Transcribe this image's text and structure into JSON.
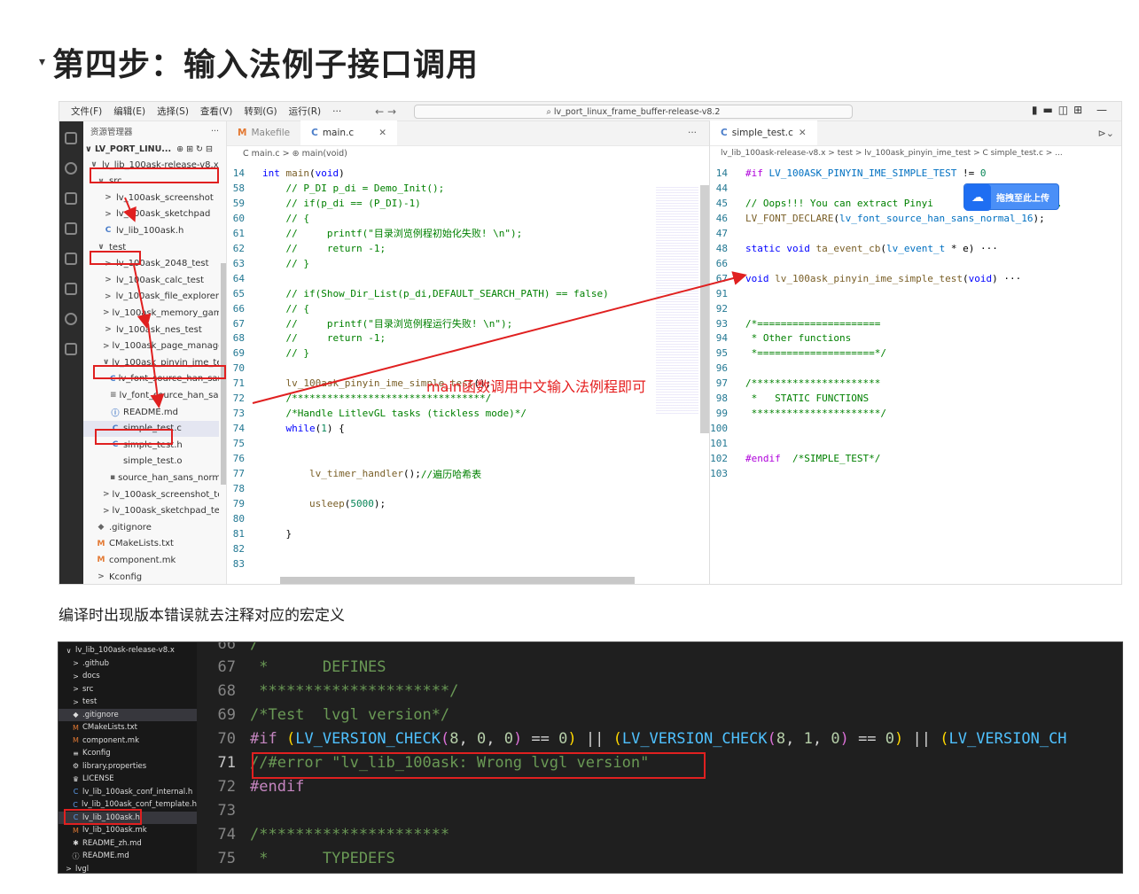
{
  "heading": {
    "text": "第四步：输入法例子接口调用"
  },
  "ss1": {
    "menu": [
      "文件(F)",
      "编辑(E)",
      "选择(S)",
      "查看(V)",
      "转到(G)",
      "运行(R)",
      "···"
    ],
    "search": "⌕ lv_port_linux_frame_buffer-release-v8.2",
    "explorer_title": "资源管理器",
    "project": "LV_PORT_LINU...",
    "tree": [
      {
        "indent": 0,
        "icon": "∨",
        "t": "lv_lib_100ask-release-v8.x",
        "cls": "ic-arr"
      },
      {
        "indent": 1,
        "icon": "∨",
        "t": "src",
        "cls": "ic-arr"
      },
      {
        "indent": 2,
        "icon": ">",
        "t": "lv_100ask_screenshot",
        "cls": "ic-arr"
      },
      {
        "indent": 2,
        "icon": ">",
        "t": "lv_100ask_sketchpad",
        "cls": "ic-arr"
      },
      {
        "indent": 2,
        "icon": "C",
        "t": "lv_lib_100ask.h",
        "cls": "ic-c"
      },
      {
        "indent": 1,
        "icon": "∨",
        "t": "test",
        "cls": "ic-arr"
      },
      {
        "indent": 2,
        "icon": ">",
        "t": "lv_100ask_2048_test",
        "cls": "ic-arr"
      },
      {
        "indent": 2,
        "icon": ">",
        "t": "lv_100ask_calc_test",
        "cls": "ic-arr"
      },
      {
        "indent": 2,
        "icon": ">",
        "t": "lv_100ask_file_explorer",
        "cls": "ic-arr"
      },
      {
        "indent": 2,
        "icon": ">",
        "t": "lv_100ask_memory_gam...",
        "cls": "ic-arr"
      },
      {
        "indent": 2,
        "icon": ">",
        "t": "lv_100ask_nes_test",
        "cls": "ic-arr"
      },
      {
        "indent": 2,
        "icon": ">",
        "t": "lv_100ask_page_manage...",
        "cls": "ic-arr"
      },
      {
        "indent": 2,
        "icon": "∨",
        "t": "lv_100ask_pinyin_ime_test",
        "cls": "ic-arr"
      },
      {
        "indent": 3,
        "icon": "C",
        "t": "lv_font_source_han_san...",
        "cls": "ic-c"
      },
      {
        "indent": 3,
        "icon": "≡",
        "t": "lv_font_source_han_san...",
        "cls": "ic-arr"
      },
      {
        "indent": 3,
        "icon": "ⓘ",
        "t": "README.md",
        "cls": "ic-c"
      },
      {
        "indent": 3,
        "icon": "C",
        "t": "simple_test.c",
        "cls": "ic-c",
        "sel": true
      },
      {
        "indent": 3,
        "icon": "C",
        "t": "simple_test.h",
        "cls": "ic-c"
      },
      {
        "indent": 3,
        "icon": "",
        "t": "simple_test.o",
        "cls": "ic-arr"
      },
      {
        "indent": 3,
        "icon": "▪",
        "t": "source_han_sans_norm...",
        "cls": "ic-arr"
      },
      {
        "indent": 2,
        "icon": ">",
        "t": "lv_100ask_screenshot_test",
        "cls": "ic-arr"
      },
      {
        "indent": 2,
        "icon": ">",
        "t": "lv_100ask_sketchpad_test",
        "cls": "ic-arr"
      },
      {
        "indent": 1,
        "icon": "◆",
        "t": ".gitignore",
        "cls": "ic-arr"
      },
      {
        "indent": 1,
        "icon": "M",
        "t": "CMakeLists.txt",
        "cls": "ic-m"
      },
      {
        "indent": 1,
        "icon": "M",
        "t": "component.mk",
        "cls": "ic-m"
      },
      {
        "indent": 1,
        "icon": ">",
        "t": "Kconfig",
        "cls": "ic-arr"
      }
    ],
    "tab_makefile": "Makefile",
    "tab_main": "main.c",
    "crumb_main": "C main.c > ⊛ main(void)",
    "code_main": [
      {
        "n": "14",
        "h": [
          [
            "kw",
            "int "
          ],
          [
            "fn",
            "main"
          ],
          [
            "pl",
            "("
          ],
          [
            "kw",
            "void"
          ],
          [
            "pl",
            ")"
          ]
        ]
      },
      {
        "n": "58",
        "h": [
          [
            "cm",
            "    // P_DI p_di = Demo_Init();"
          ]
        ]
      },
      {
        "n": "59",
        "h": [
          [
            "cm",
            "    // if(p_di == (P_DI)-1)"
          ]
        ]
      },
      {
        "n": "60",
        "h": [
          [
            "cm",
            "    // {"
          ]
        ]
      },
      {
        "n": "61",
        "h": [
          [
            "cm",
            "    //     printf(\"目录浏览例程初始化失败! \\n\");"
          ]
        ]
      },
      {
        "n": "62",
        "h": [
          [
            "cm",
            "    //     return -1;"
          ]
        ]
      },
      {
        "n": "63",
        "h": [
          [
            "cm",
            "    // }"
          ]
        ]
      },
      {
        "n": "64",
        "h": []
      },
      {
        "n": "65",
        "h": [
          [
            "cm",
            "    // if(Show_Dir_List(p_di,DEFAULT_SEARCH_PATH) == false)"
          ]
        ]
      },
      {
        "n": "66",
        "h": [
          [
            "cm",
            "    // {"
          ]
        ]
      },
      {
        "n": "67",
        "h": [
          [
            "cm",
            "    //     printf(\"目录浏览例程运行失败! \\n\");"
          ]
        ]
      },
      {
        "n": "68",
        "h": [
          [
            "cm",
            "    //     return -1;"
          ]
        ]
      },
      {
        "n": "69",
        "h": [
          [
            "cm",
            "    // }"
          ]
        ]
      },
      {
        "n": "70",
        "h": []
      },
      {
        "n": "71",
        "h": [
          [
            "fn",
            "    lv_100ask_pinyin_ime_simple_test"
          ],
          [
            "pl",
            "();"
          ]
        ]
      },
      {
        "n": "72",
        "h": [
          [
            "cm",
            "    /*********************************/"
          ]
        ]
      },
      {
        "n": "73",
        "h": [
          [
            "cm",
            "    /*Handle LitlevGL tasks (tickless mode)*/"
          ]
        ]
      },
      {
        "n": "74",
        "h": [
          [
            "kw",
            "    while"
          ],
          [
            "pl",
            "("
          ],
          [
            "nm",
            "1"
          ],
          [
            "pl",
            ") {"
          ]
        ]
      },
      {
        "n": "75",
        "h": []
      },
      {
        "n": "76",
        "h": []
      },
      {
        "n": "77",
        "h": [
          [
            "fn",
            "        lv_timer_handler"
          ],
          [
            "pl",
            "();"
          ],
          [
            "cm",
            "//遍历哈希表"
          ]
        ]
      },
      {
        "n": "78",
        "h": []
      },
      {
        "n": "79",
        "h": [
          [
            "fn",
            "        usleep"
          ],
          [
            "pl",
            "("
          ],
          [
            "nm",
            "5000"
          ],
          [
            "pl",
            ");"
          ]
        ]
      },
      {
        "n": "80",
        "h": []
      },
      {
        "n": "81",
        "h": [
          [
            "pl",
            "    }"
          ]
        ]
      },
      {
        "n": "82",
        "h": []
      },
      {
        "n": "83",
        "h": []
      }
    ],
    "tab_simple": "simple_test.c",
    "crumb_simple": "lv_lib_100ask-release-v8.x > test > lv_100ask_pinyin_ime_test > C simple_test.c > ...",
    "code_simple": [
      {
        "n": "14",
        "h": [
          [
            "pp",
            "#if "
          ],
          [
            "mc",
            "LV_100ASK_PINYIN_IME_SIMPLE_TEST"
          ],
          [
            "pl",
            " != "
          ],
          [
            "nm",
            "0"
          ]
        ]
      },
      {
        "n": "44",
        "h": []
      },
      {
        "n": "45",
        "h": [
          [
            "cm",
            "// Oops!!! You can extract Pinyi"
          ],
          [
            "pl",
            "                   "
          ],
          [
            "cm",
            "it."
          ]
        ]
      },
      {
        "n": "46",
        "h": [
          [
            "fn",
            "LV_FONT_DECLARE"
          ],
          [
            "pl",
            "("
          ],
          [
            "mc",
            "lv_font_source_han_sans_normal_16"
          ],
          [
            "pl",
            ");"
          ]
        ]
      },
      {
        "n": "47",
        "h": []
      },
      {
        "n": "48",
        "h": [
          [
            "kw",
            "static void "
          ],
          [
            "fn",
            "ta_event_cb"
          ],
          [
            "pl",
            "("
          ],
          [
            "mc",
            "lv_event_t"
          ],
          [
            "pl",
            " * e)"
          ],
          [
            "pl",
            " ···"
          ]
        ]
      },
      {
        "n": "66",
        "h": []
      },
      {
        "n": "67",
        "h": [
          [
            "kw",
            "void "
          ],
          [
            "fn",
            "lv_100ask_pinyin_ime_simple_test"
          ],
          [
            "pl",
            "("
          ],
          [
            "kw",
            "void"
          ],
          [
            "pl",
            ")"
          ],
          [
            "pl",
            " ···"
          ]
        ]
      },
      {
        "n": "91",
        "h": []
      },
      {
        "n": "92",
        "h": []
      },
      {
        "n": "93",
        "h": [
          [
            "cm",
            "/*====================="
          ]
        ]
      },
      {
        "n": "94",
        "h": [
          [
            "cm",
            " * Other functions"
          ]
        ]
      },
      {
        "n": "95",
        "h": [
          [
            "cm",
            " *====================*/"
          ]
        ]
      },
      {
        "n": "96",
        "h": []
      },
      {
        "n": "97",
        "h": [
          [
            "cm",
            "/**********************"
          ]
        ]
      },
      {
        "n": "98",
        "h": [
          [
            "cm",
            " *   STATIC FUNCTIONS"
          ]
        ]
      },
      {
        "n": "99",
        "h": [
          [
            "cm",
            " **********************/"
          ]
        ]
      },
      {
        "n": "100",
        "h": []
      },
      {
        "n": "101",
        "h": []
      },
      {
        "n": "102",
        "h": [
          [
            "pp",
            "#endif"
          ],
          [
            "cm",
            "  /*SIMPLE_TEST*/"
          ]
        ]
      },
      {
        "n": "103",
        "h": []
      }
    ],
    "baidu_label": "拖拽至此上传",
    "annotation": "main函数调用中文输入法例程即可"
  },
  "caption": "编译时出现版本错误就去注释对应的宏定义",
  "ss2": {
    "tree": [
      {
        "indent": 0,
        "icon": "∨",
        "t": "lv_lib_100ask-release-v8.x"
      },
      {
        "indent": 1,
        "icon": ">",
        "t": ".github"
      },
      {
        "indent": 1,
        "icon": ">",
        "t": "docs"
      },
      {
        "indent": 1,
        "icon": ">",
        "t": "src"
      },
      {
        "indent": 1,
        "icon": ">",
        "t": "test"
      },
      {
        "indent": 1,
        "icon": "◆",
        "t": ".gitignore",
        "sel": true
      },
      {
        "indent": 1,
        "icon": "M",
        "t": "CMakeLists.txt"
      },
      {
        "indent": 1,
        "icon": "M",
        "t": "component.mk"
      },
      {
        "indent": 1,
        "icon": "≡",
        "t": "Kconfig"
      },
      {
        "indent": 1,
        "icon": "⚙",
        "t": "library.properties"
      },
      {
        "indent": 1,
        "icon": "♛",
        "t": "LICENSE"
      },
      {
        "indent": 1,
        "icon": "C",
        "t": "lv_lib_100ask_conf_internal.h"
      },
      {
        "indent": 1,
        "icon": "C",
        "t": "lv_lib_100ask_conf_template.h"
      },
      {
        "indent": 1,
        "icon": "C",
        "t": "lv_lib_100ask.h",
        "sel": true
      },
      {
        "indent": 1,
        "icon": "M",
        "t": "lv_lib_100ask.mk"
      },
      {
        "indent": 1,
        "icon": "✱",
        "t": "README_zh.md"
      },
      {
        "indent": 1,
        "icon": "ⓘ",
        "t": "README.md"
      },
      {
        "indent": 0,
        "icon": ">",
        "t": "lvgl"
      }
    ],
    "code": [
      {
        "n": "66",
        "h": [
          [
            "d-cm",
            "/"
          ]
        ]
      },
      {
        "n": "67",
        "h": [
          [
            "d-cm",
            " *      DEFINES"
          ]
        ]
      },
      {
        "n": "68",
        "h": [
          [
            "d-cm",
            " *********************/"
          ]
        ]
      },
      {
        "n": "69",
        "h": [
          [
            "d-cm",
            "/*Test  lvgl version*/"
          ]
        ]
      },
      {
        "n": "70",
        "h": [
          [
            "d-pp",
            "#if "
          ],
          [
            "d-op",
            "("
          ],
          [
            "d-fn",
            "LV_VERSION_CHECK"
          ],
          [
            "d-br",
            "("
          ],
          [
            "d-nm",
            "8"
          ],
          [
            "d-pl",
            ", "
          ],
          [
            "d-nm",
            "0"
          ],
          [
            "d-pl",
            ", "
          ],
          [
            "d-nm",
            "0"
          ],
          [
            "d-br",
            ")"
          ],
          [
            "d-pl",
            " == "
          ],
          [
            "d-nm",
            "0"
          ],
          [
            "d-op",
            ")"
          ],
          [
            "d-pl",
            " || "
          ],
          [
            "d-op",
            "("
          ],
          [
            "d-fn",
            "LV_VERSION_CHECK"
          ],
          [
            "d-br",
            "("
          ],
          [
            "d-nm",
            "8"
          ],
          [
            "d-pl",
            ", "
          ],
          [
            "d-nm",
            "1"
          ],
          [
            "d-pl",
            ", "
          ],
          [
            "d-nm",
            "0"
          ],
          [
            "d-br",
            ")"
          ],
          [
            "d-pl",
            " == "
          ],
          [
            "d-nm",
            "0"
          ],
          [
            "d-op",
            ")"
          ],
          [
            "d-pl",
            " || "
          ],
          [
            "d-op",
            "("
          ],
          [
            "d-fn",
            "LV_VERSION_CH"
          ]
        ]
      },
      {
        "n": "71",
        "h": [
          [
            "d-cm",
            "//#error \"lv_lib_100ask: Wrong lvgl version\""
          ]
        ],
        "cur": true
      },
      {
        "n": "72",
        "h": [
          [
            "d-pp",
            "#endif"
          ]
        ]
      },
      {
        "n": "73",
        "h": []
      },
      {
        "n": "74",
        "h": [
          [
            "d-cm",
            "/*********************"
          ]
        ]
      },
      {
        "n": "75",
        "h": [
          [
            "d-cm",
            " *      TYPEDEFS"
          ]
        ]
      }
    ]
  }
}
